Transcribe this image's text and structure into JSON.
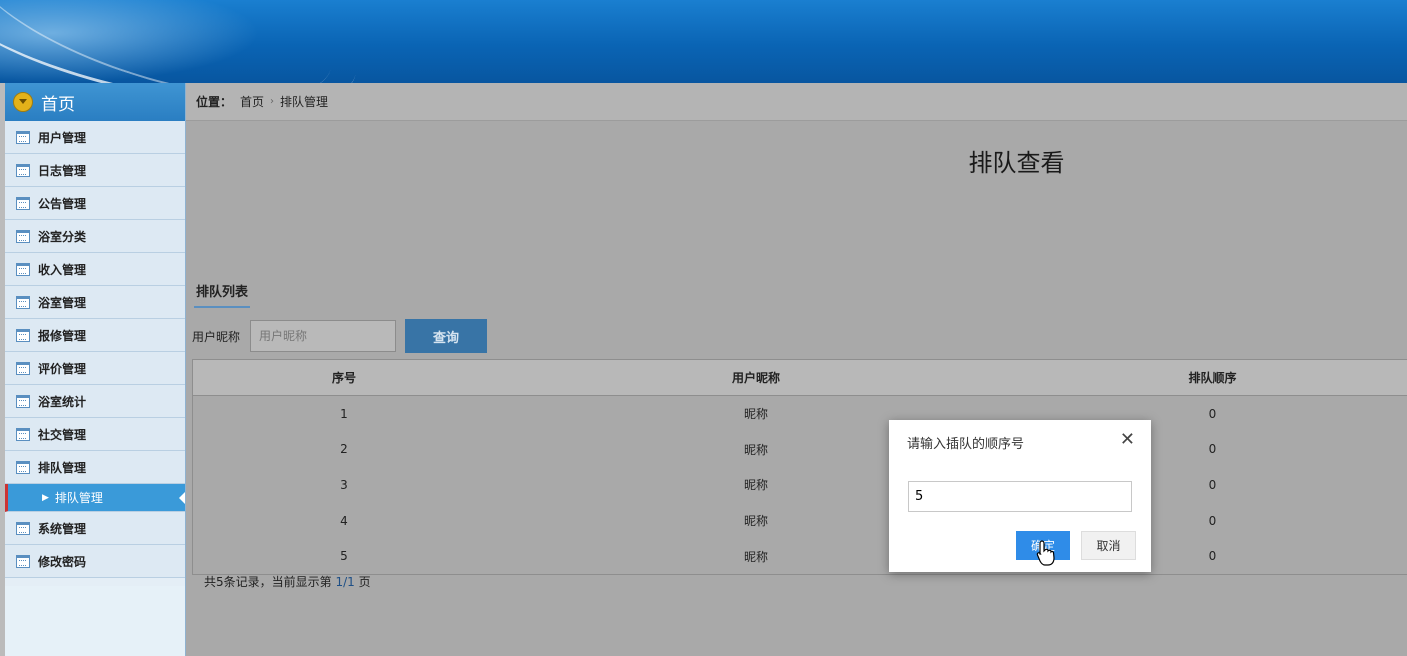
{
  "sidebar": {
    "home_label": "首页",
    "items": [
      {
        "label": "用户管理"
      },
      {
        "label": "日志管理"
      },
      {
        "label": "公告管理"
      },
      {
        "label": "浴室分类"
      },
      {
        "label": "收入管理"
      },
      {
        "label": "浴室管理"
      },
      {
        "label": "报修管理"
      },
      {
        "label": "评价管理"
      },
      {
        "label": "浴室统计"
      },
      {
        "label": "社交管理"
      },
      {
        "label": "排队管理"
      }
    ],
    "active_sub": "排队管理",
    "items_after": [
      {
        "label": "系统管理"
      },
      {
        "label": "修改密码"
      }
    ]
  },
  "breadcrumb": {
    "label": "位置：",
    "home": "首页",
    "current": "排队管理"
  },
  "page": {
    "title": "排队查看",
    "list_tab": "排队列表"
  },
  "search": {
    "label": "用户昵称",
    "placeholder": "用户昵称",
    "button": "查询"
  },
  "table": {
    "columns": [
      "序号",
      "用户昵称",
      "排队顺序"
    ],
    "rows": [
      [
        "1",
        "昵称",
        "0"
      ],
      [
        "2",
        "昵称",
        "0"
      ],
      [
        "3",
        "昵称",
        "0"
      ],
      [
        "4",
        "昵称",
        "0"
      ],
      [
        "5",
        "昵称",
        "0"
      ]
    ]
  },
  "footer": {
    "prefix": "共5条记录，当前显示第 ",
    "page": "1/1",
    "suffix": " 页"
  },
  "dialog": {
    "title": "请输入插队的顺序号",
    "value": "5",
    "ok": "确定",
    "cancel": "取消"
  },
  "colors": {
    "header_blue": "#0a64b4",
    "active_menu": "#3a9ad9",
    "query_button": "#3874a6",
    "ok_button": "#2f8ce8"
  }
}
